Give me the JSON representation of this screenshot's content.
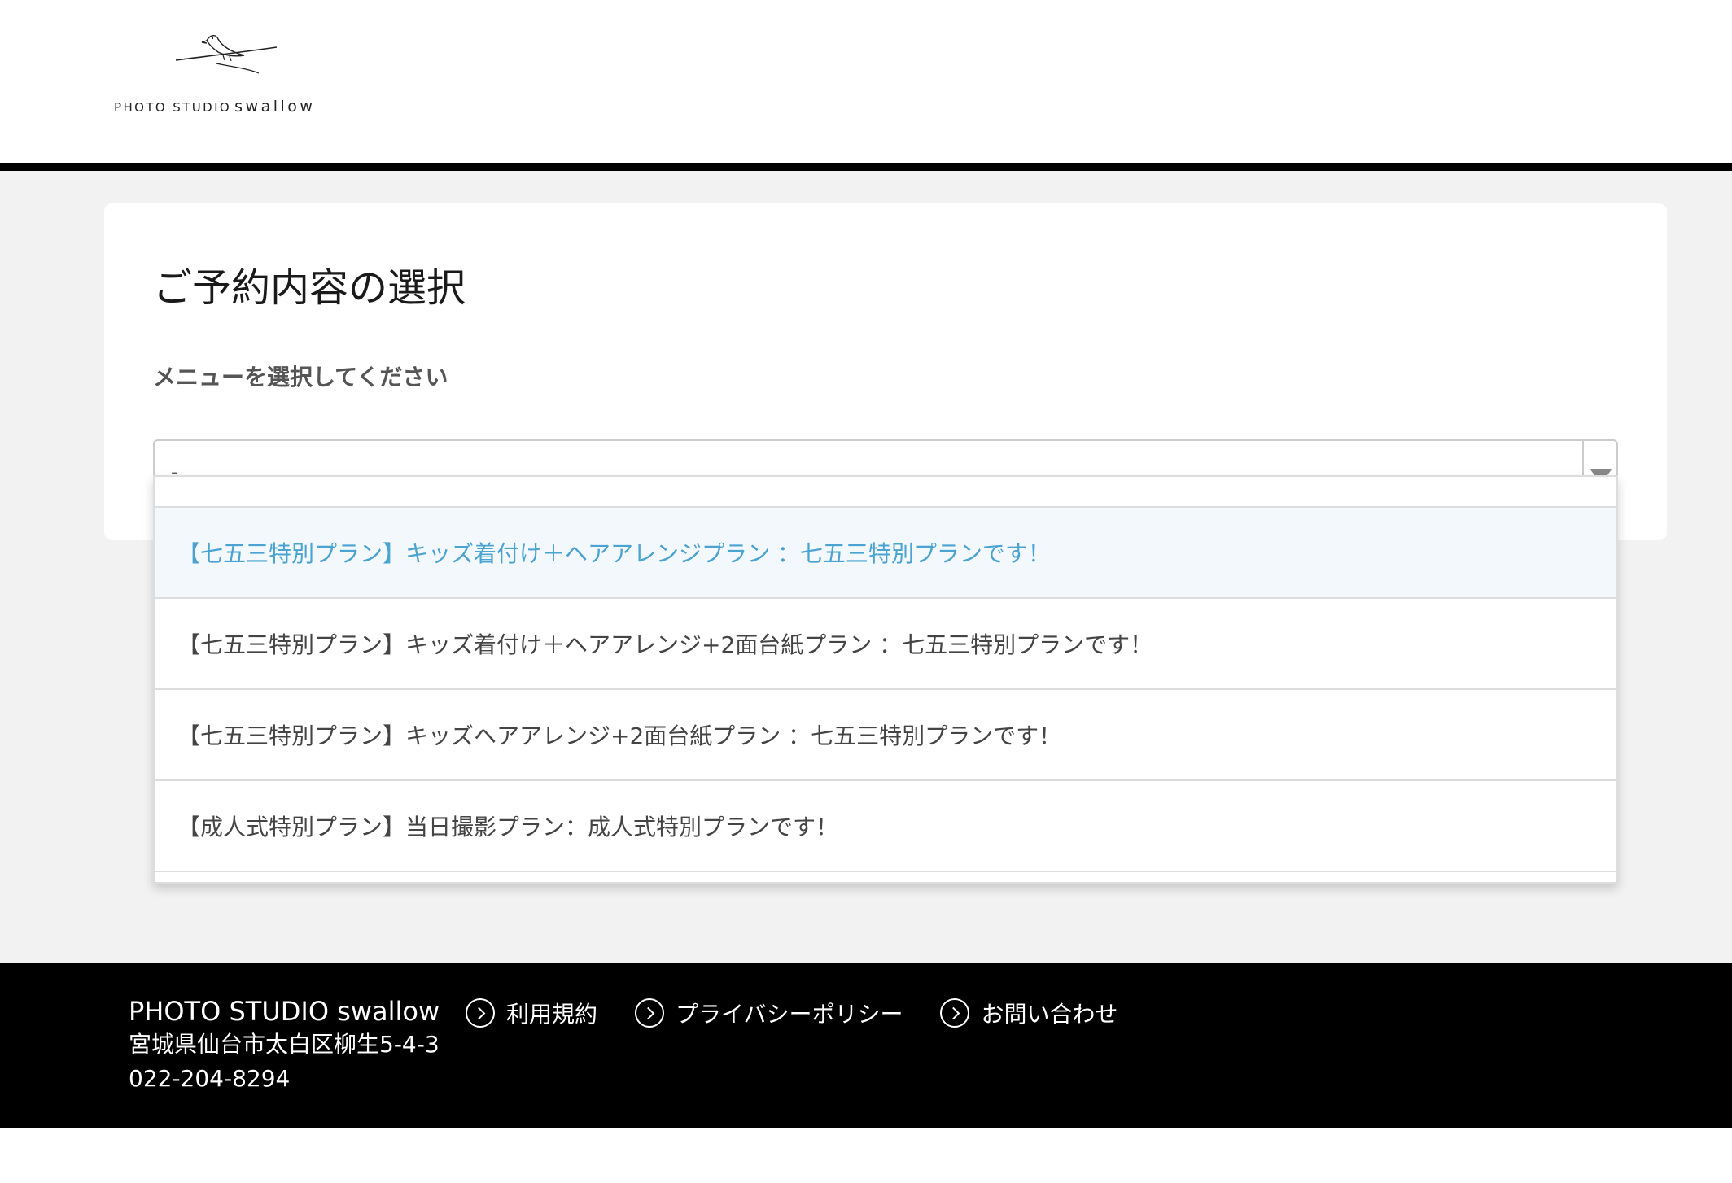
{
  "header": {
    "logo_text_small": "PHOTO STUDIO",
    "logo_text_big": "swallow"
  },
  "main": {
    "title": "ご予約内容の選択",
    "menu_label": "メニューを選択してください",
    "select": {
      "value": "-"
    },
    "options": [
      "【七五三特別プラン】キッズ着付け＋ヘアアレンジプラン ：七五三特別プランです！",
      "【七五三特別プラン】キッズ着付け＋ヘアアレンジ+2面台紙プラン ：七五三特別プランです！",
      "【七五三特別プラン】キッズヘアアレンジ+2面台紙プラン ：七五三特別プランです！",
      "【成人式特別プラン】当日撮影プラン：成人式特別プランです！"
    ],
    "active_option_index": 0
  },
  "footer": {
    "studio_name": "PHOTO STUDIO swallow",
    "address": "宮城県仙台市太白区柳生5-4-3",
    "phone": "022-204-8294",
    "links": [
      {
        "label": "利用規約",
        "icon": "chevron-circle-right-icon"
      },
      {
        "label": "プライバシーポリシー",
        "icon": "chevron-circle-right-icon"
      },
      {
        "label": "お問い合わせ",
        "icon": "chevron-circle-right-icon"
      }
    ]
  },
  "colors": {
    "header_rule": "#000000",
    "page_background": "#f2f2f2",
    "active_option_text": "#4aa3d1",
    "active_option_background": "#f2f8fb",
    "footer_background": "#000000"
  }
}
